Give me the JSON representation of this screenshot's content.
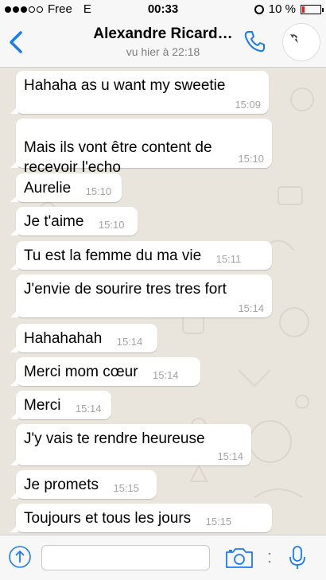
{
  "status_bar": {
    "carrier": "Free",
    "network": "E",
    "time": "00:33",
    "battery": "10 %",
    "battery_level": 0.1
  },
  "header": {
    "back_icon": "chevron-left-icon",
    "contact_name": "Alexandre Ricard…",
    "last_seen": "vu hier à 22:18",
    "call_icon": "phone-icon"
  },
  "messages": [
    {
      "text": "Hahaha as u want my sweetie",
      "time": "15:09"
    },
    {
      "text": "Mais ils vont être content de\nrecevoir l'echo",
      "time": "15:10"
    },
    {
      "text": "Aurelie",
      "time": "15:10"
    },
    {
      "text": "Je t'aime",
      "time": "15:10"
    },
    {
      "text": "Tu est la femme du ma vie",
      "time": "15:11"
    },
    {
      "text": "J'envie de sourire tres tres fort",
      "time": "15:14"
    },
    {
      "text": "Hahahahah",
      "time": "15:14"
    },
    {
      "text": "Merci mom cœur",
      "time": "15:14"
    },
    {
      "text": "Merci",
      "time": "15:14"
    },
    {
      "text": "J'y vais te rendre heureuse",
      "time": "15:14"
    },
    {
      "text": "Je promets",
      "time": "15:15"
    },
    {
      "text": "Toujours et tous les jours",
      "time": "15:15"
    }
  ],
  "input_bar": {
    "message_value": "",
    "share_icon": "upload-arrow-icon",
    "camera_icon": "camera-icon",
    "mic_icon": "microphone-icon"
  },
  "colors": {
    "accent": "#1a7cf5",
    "bubble": "#ffffff",
    "chat_background": "#e9e4dc",
    "timestamp": "#a4a4a4"
  }
}
